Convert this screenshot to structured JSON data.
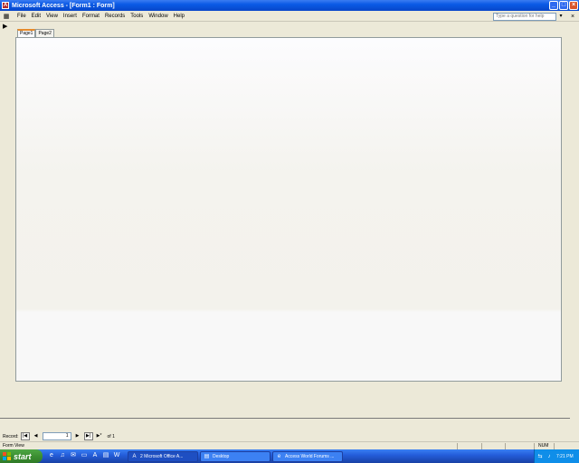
{
  "window": {
    "title": "Microsoft Access - [Form1 : Form]",
    "buttons": [
      "minimize",
      "maximize",
      "close"
    ]
  },
  "menubar": {
    "items": [
      "File",
      "Edit",
      "View",
      "Insert",
      "Format",
      "Records",
      "Tools",
      "Window",
      "Help"
    ],
    "help_placeholder": "Type a question for help",
    "help_arrow": "▾",
    "doc_close": "×"
  },
  "form": {
    "record_arrow": "▶",
    "tabs": [
      "Page1",
      "Page2"
    ],
    "active_tab": 0
  },
  "record_nav": {
    "label": "Record:",
    "first": "|◀",
    "prev": "◀",
    "current": "1",
    "next": "▶",
    "last": "▶|",
    "new": "▶*",
    "count": "of 1"
  },
  "statusbar": {
    "text": "Form View",
    "num": "NUM"
  },
  "taskbar": {
    "start_label": "start",
    "quick_launch_icons": [
      "ie-icon",
      "media-icon",
      "mail-icon",
      "desktop-icon",
      "access-icon",
      "folder-icon",
      "word-icon"
    ],
    "tasks": [
      {
        "label": "2 Microsoft Office A...",
        "icon": "access-icon",
        "active": true
      },
      {
        "label": "Desktop",
        "icon": "folder-icon",
        "active": false
      },
      {
        "label": "Access World Forums ...",
        "icon": "browser-icon",
        "active": false
      }
    ],
    "clock": "7:21 PM"
  }
}
